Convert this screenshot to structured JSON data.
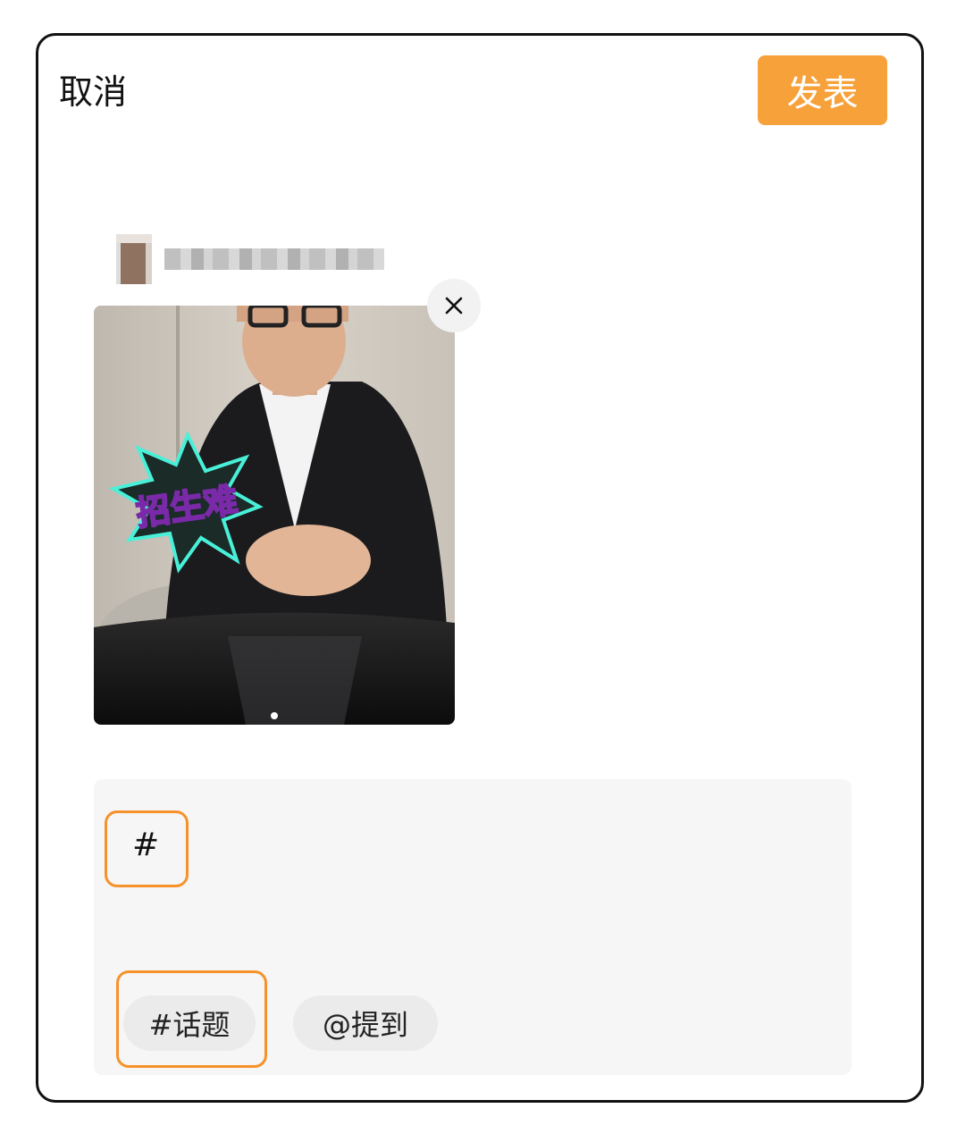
{
  "header": {
    "cancel_label": "取消",
    "publish_label": "发表"
  },
  "post": {
    "video_sticker_text": "招生难",
    "close_symbol": "×"
  },
  "editor": {
    "text_value": "#"
  },
  "toolbar": {
    "topic_label": "#话题",
    "mention_label": "@提到"
  },
  "colors": {
    "accent": "#f7a13a",
    "highlight": "#f7922a"
  }
}
